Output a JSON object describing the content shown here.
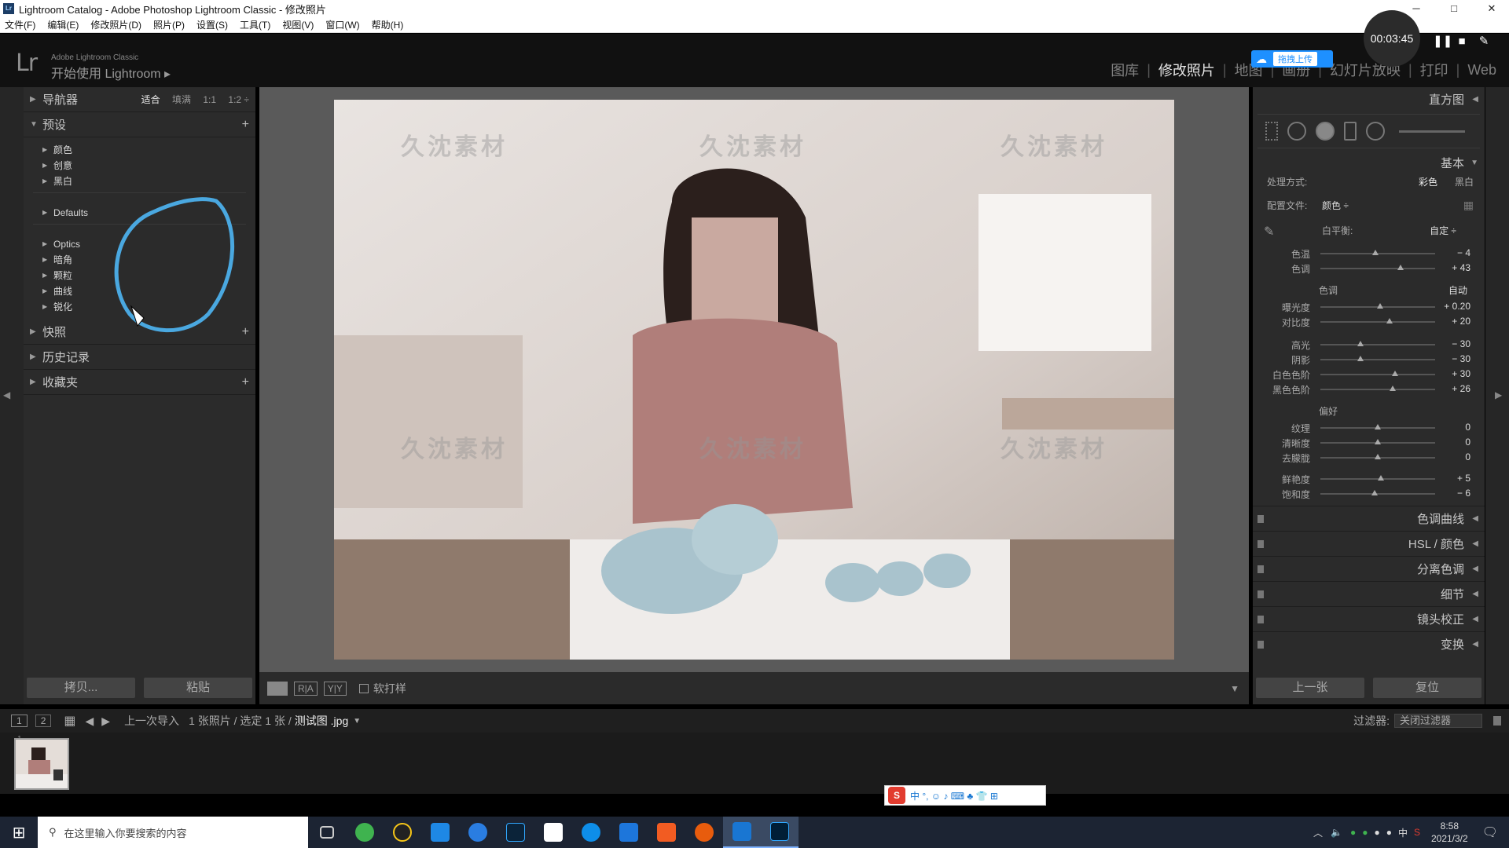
{
  "window": {
    "title": "Lightroom Catalog - Adobe Photoshop Lightroom Classic - 修改照片",
    "minimize": "─",
    "maximize": "□",
    "close": "✕"
  },
  "menu": [
    "文件(F)",
    "编辑(E)",
    "修改照片(D)",
    "照片(P)",
    "设置(S)",
    "工具(T)",
    "视图(V)",
    "窗口(W)",
    "帮助(H)"
  ],
  "recorder": {
    "time": "00:03:45"
  },
  "identity": {
    "logo": "Lr",
    "product": "Adobe Lightroom Classic",
    "start": "开始使用 Lightroom ▸"
  },
  "modules": [
    "图库",
    "修改照片",
    "地图",
    "画册",
    "幻灯片放映",
    "打印",
    "Web"
  ],
  "upload_badge": {
    "label": "拖拽上传"
  },
  "left_panel": {
    "navigator": {
      "title": "导航器",
      "options": [
        "适合",
        "填满",
        "1:1",
        "1:2 ÷"
      ]
    },
    "presets": {
      "title": "预设",
      "items": [
        "颜色",
        "创意",
        "黑白"
      ],
      "defaults": "Defaults",
      "items2": [
        "Optics",
        "暗角",
        "颗粒",
        "曲线",
        "锐化"
      ]
    },
    "snapshots": "快照",
    "history": "历史记录",
    "collections": "收藏夹",
    "copy_button": "拷贝...",
    "paste_button": "粘贴"
  },
  "watermark": "久沈素材",
  "toolbar": {
    "soft_proof": "软打样"
  },
  "right_panel": {
    "histogram": "直方图",
    "basic": "基本",
    "treatment_label": "处理方式:",
    "treatment_color": "彩色",
    "treatment_bw": "黑白",
    "profile_label": "配置文件:",
    "profile_value": "颜色 ÷",
    "wb_label": "白平衡:",
    "wb_value": "自定 ÷",
    "wb_sliders": [
      {
        "label": "色温",
        "value": "− 4",
        "pos": 0.48
      },
      {
        "label": "色调",
        "value": "+ 43",
        "pos": 0.7
      }
    ],
    "tone_label": "色调",
    "tone_auto": "自动",
    "tone_sliders": [
      {
        "label": "曝光度",
        "value": "+ 0.20",
        "pos": 0.52
      },
      {
        "label": "对比度",
        "value": "+ 20",
        "pos": 0.6
      }
    ],
    "tone_sliders2": [
      {
        "label": "高光",
        "value": "− 30",
        "pos": 0.35
      },
      {
        "label": "阴影",
        "value": "− 30",
        "pos": 0.35
      },
      {
        "label": "白色色阶",
        "value": "+ 30",
        "pos": 0.65
      },
      {
        "label": "黑色色阶",
        "value": "+ 26",
        "pos": 0.63
      }
    ],
    "presence_label": "偏好",
    "presence_sliders": [
      {
        "label": "纹理",
        "value": "0",
        "pos": 0.5
      },
      {
        "label": "清晰度",
        "value": "0",
        "pos": 0.5
      },
      {
        "label": "去朦胧",
        "value": "0",
        "pos": 0.5
      }
    ],
    "presence_sliders2": [
      {
        "label": "鲜艳度",
        "value": "+ 5",
        "pos": 0.53
      },
      {
        "label": "饱和度",
        "value": "− 6",
        "pos": 0.47
      }
    ],
    "sections": [
      "色调曲线",
      "HSL / 颜色",
      "分离色调",
      "细节",
      "镜头校正",
      "变换"
    ],
    "prev_button": "上一张",
    "reset_button": "复位"
  },
  "filmstrip": {
    "views": [
      "1",
      "2"
    ],
    "source": "上一次导入",
    "count": "1 张照片 / 选定 1 张 /",
    "filename": "测试图 .jpg",
    "filter_label": "过滤器:",
    "filter_value": "关闭过滤器",
    "thumb_number": "1"
  },
  "taskbar": {
    "search_placeholder": "在这里输入你要搜索的内容",
    "ime_lang": "中",
    "time": "8:58",
    "date": "2021/3/2"
  },
  "ime_bar": {
    "items": "中 °, ☺ ♪ ⌨ ♣ 👕 ⊞"
  }
}
